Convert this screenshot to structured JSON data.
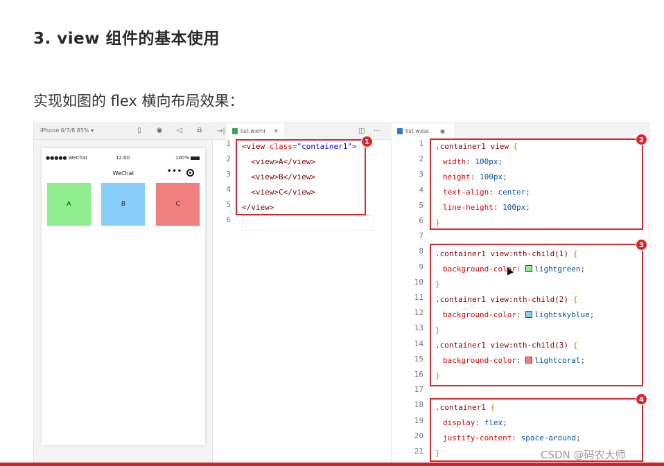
{
  "page": {
    "heading": "3. view 组件的基本使用",
    "subheading": "实现如图的 flex 横向布局效果："
  },
  "simulator": {
    "device_label": "iPhone 6/7/8 85% ▾",
    "status_left": "●●●●● WeChat",
    "status_time": "12:00",
    "status_battery": "100%",
    "nav_title": "WeChat",
    "capsule_dots": "•••",
    "boxes": [
      {
        "label": "A",
        "color": "#90ee90"
      },
      {
        "label": "B",
        "color": "#87cefa"
      },
      {
        "label": "C",
        "color": "#f08080"
      }
    ]
  },
  "wxml_editor": {
    "tab_label": "list.wxml",
    "tab_close": "✕",
    "split_icon": "◫",
    "more_icon": "···",
    "line_numbers": [
      "1",
      "2",
      "3",
      "4",
      "5",
      "6"
    ],
    "lines": [
      {
        "tag_open": "<view",
        "attr": " class",
        "eq": "=",
        "str": "\"container1\"",
        "close": ">"
      },
      {
        "indent": "  ",
        "code": "<view>A</view>"
      },
      {
        "indent": "  ",
        "code": "<view>B</view>"
      },
      {
        "indent": "  ",
        "code": "<view>C</view>"
      },
      {
        "code": "</view>"
      },
      {
        "code": ""
      }
    ],
    "badge": "1"
  },
  "wxss_editor": {
    "tab_label": "list.wxss",
    "tab_dot": "●",
    "line_numbers": [
      "1",
      "2",
      "3",
      "4",
      "5",
      "6",
      "7",
      "8",
      "9",
      "10",
      "11",
      "12",
      "13",
      "14",
      "15",
      "16",
      "17",
      "18",
      "19",
      "20",
      "21"
    ],
    "block1": {
      "selector": ".container1 view",
      "brace_open": "{",
      "decls": [
        {
          "prop": "width",
          "val": "100px"
        },
        {
          "prop": "height",
          "val": "100px"
        },
        {
          "prop": "text-align",
          "val": "center"
        },
        {
          "prop": "line-height",
          "val": "100px"
        }
      ],
      "brace_close": "}",
      "badge": "2"
    },
    "block2": {
      "rules": [
        {
          "selector": ".container1 view:nth-child(1)",
          "prop": "background-color",
          "val": "lightgreen",
          "swatch": "#90ee90"
        },
        {
          "selector": ".container1 view:nth-child(2)",
          "prop": "background-color",
          "val": "lightskyblue",
          "swatch": "#87cefa"
        },
        {
          "selector": ".container1 view:nth-child(3)",
          "prop": "background-color",
          "val": "lightcoral",
          "swatch": "#f08080"
        }
      ],
      "brace_open": "{",
      "brace_close": "}",
      "badge": "3"
    },
    "block3": {
      "selector": ".container1",
      "brace_open": "{",
      "decls": [
        {
          "prop": "display",
          "val": "flex"
        },
        {
          "prop": "justify-content",
          "val": "space-around"
        }
      ],
      "brace_close": "}",
      "badge": "4"
    }
  },
  "watermark": "CSDN @码农大师",
  "colors": {
    "annotation_red": "#d9262c",
    "bottom_rule": "#c6282f"
  }
}
